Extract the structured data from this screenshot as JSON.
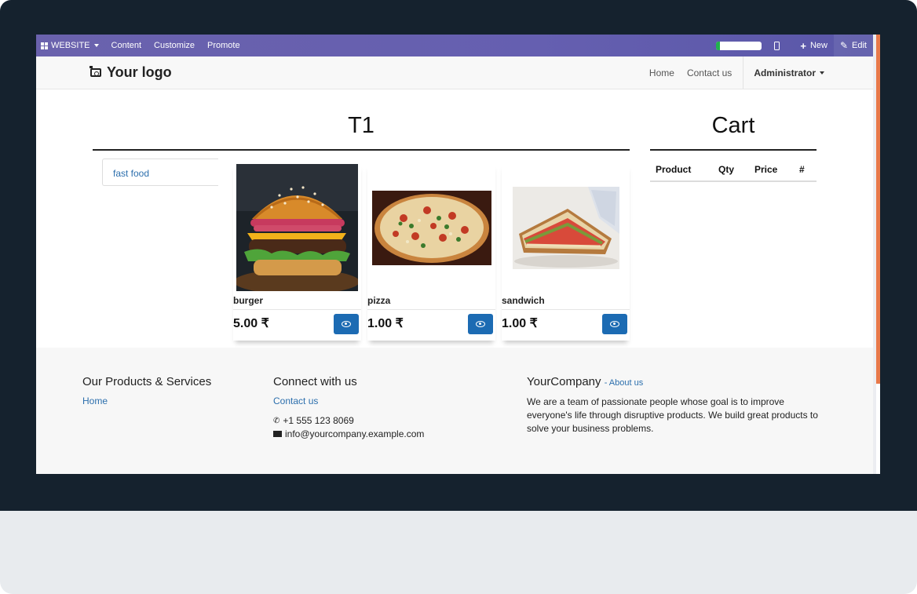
{
  "editor_bar": {
    "website_label": "WEBSITE",
    "menu": [
      "Content",
      "Customize",
      "Promote"
    ],
    "progress_value": 0.08,
    "new_label": "New",
    "edit_label": "Edit"
  },
  "header": {
    "logo_text": "Your logo",
    "nav": [
      "Home",
      "Contact us"
    ],
    "user": "Administrator"
  },
  "main": {
    "section_title": "T1",
    "category": "fast food",
    "products": [
      {
        "name": "burger",
        "price": "5.00 ₹"
      },
      {
        "name": "pizza",
        "price": "1.00 ₹"
      },
      {
        "name": "sandwich",
        "price": "1.00 ₹"
      }
    ]
  },
  "cart": {
    "title": "Cart",
    "columns": [
      "Product",
      "Qty",
      "Price",
      "#"
    ]
  },
  "footer": {
    "col1_title": "Our Products & Services",
    "col1_link": "Home",
    "col2_title": "Connect with us",
    "col2_link": "Contact us",
    "phone": "+1 555 123 8069",
    "email": "info@yourcompany.example.com",
    "company": "YourCompany",
    "about_link": "- About us",
    "about_text": "We are a team of passionate people whose goal is to improve everyone's life through disruptive products. We build great products to solve your business problems."
  },
  "colors": {
    "editor_bar": "#655fb0",
    "primary_button": "#1c6bb3",
    "link": "#2c6fad",
    "progress_green": "#21b24d"
  }
}
